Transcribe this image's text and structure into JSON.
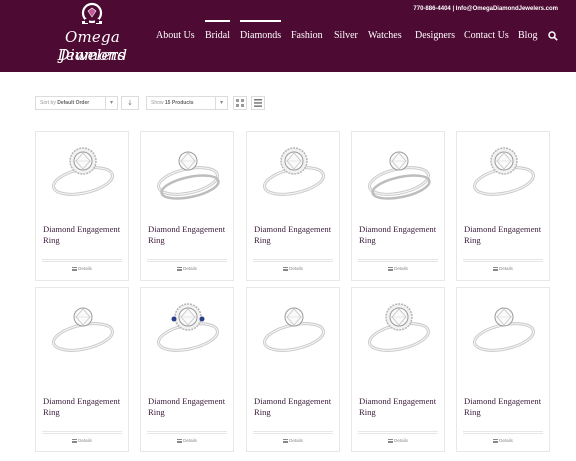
{
  "brand": {
    "name_line1": "Omega Diamond",
    "name_line2": "Jewelers"
  },
  "contact": {
    "text": "770-886-4404 | Info@OmegaDiamondJewelers.com"
  },
  "nav": {
    "items": [
      {
        "label": "About Us",
        "active": false
      },
      {
        "label": "Bridal",
        "active": true
      },
      {
        "label": "Diamonds",
        "active": true
      },
      {
        "label": "Fashion",
        "active": false
      },
      {
        "label": "Silver",
        "active": false
      },
      {
        "label": "Watches",
        "active": false
      },
      {
        "label": "Designers",
        "active": false
      },
      {
        "label": "Contact Us",
        "active": false
      },
      {
        "label": "Blog",
        "active": false
      }
    ],
    "search_icon": "search-icon"
  },
  "toolbar": {
    "sort_prefix": "Sort by",
    "sort_value": "Default Order",
    "sort_direction_icon": "arrow-down-icon",
    "show_prefix": "Show",
    "show_value": "15 Products",
    "view_grid_icon": "grid-view-icon",
    "view_list_icon": "list-view-icon"
  },
  "products": [
    {
      "name": "Diamond Engagement Ring",
      "details_label": "Details"
    },
    {
      "name": "Diamond Engagement Ring",
      "details_label": "Details"
    },
    {
      "name": "Diamond Engagement Ring",
      "details_label": "Details"
    },
    {
      "name": "Diamond Engagement Ring",
      "details_label": "Details"
    },
    {
      "name": "Diamond Engagement Ring",
      "details_label": "Details"
    },
    {
      "name": "Diamond Engagement Ring",
      "details_label": "Details"
    },
    {
      "name": "Diamond Engagement Ring",
      "details_label": "Details"
    },
    {
      "name": "Diamond Engagement Ring",
      "details_label": "Details"
    },
    {
      "name": "Diamond Engagement Ring",
      "details_label": "Details"
    },
    {
      "name": "Diamond Engagement Ring",
      "details_label": "Details"
    }
  ],
  "colors": {
    "header_bg": "#4d0a33",
    "title_text": "#3a1a3a",
    "accent_sapphire": "#2a3e8c"
  }
}
